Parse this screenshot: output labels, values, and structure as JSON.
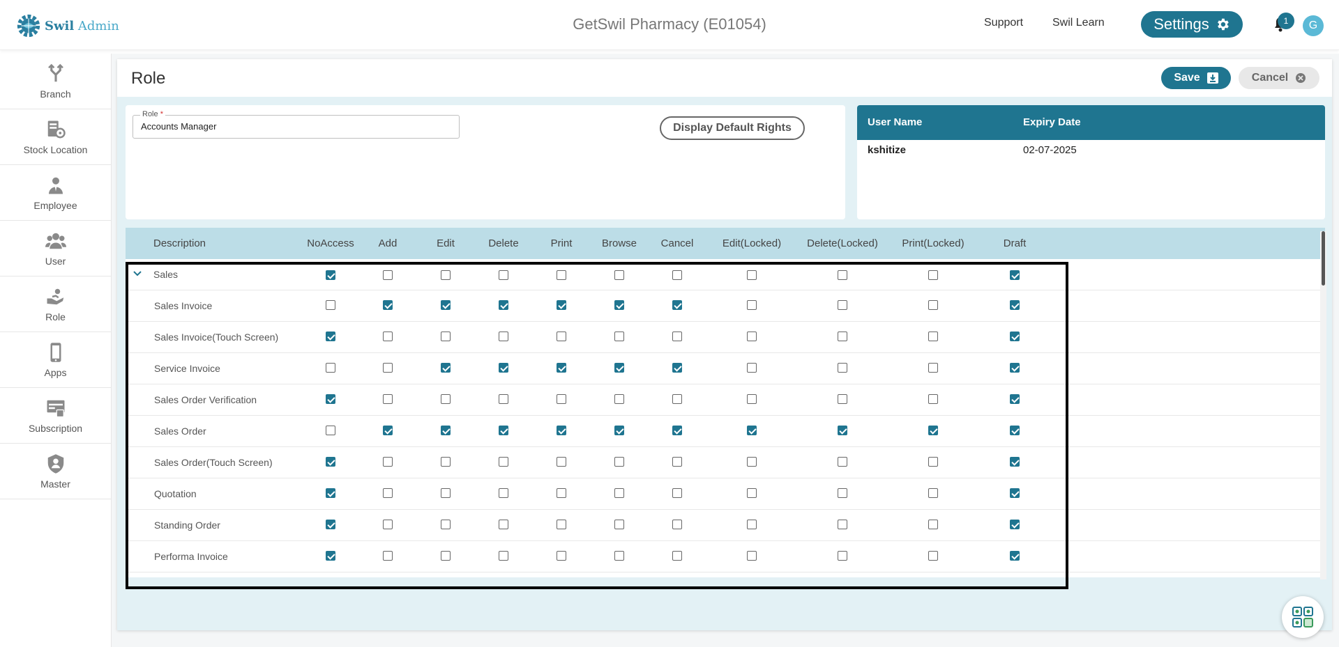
{
  "brand": {
    "name": "Swil",
    "suffix": " Admin"
  },
  "header": {
    "title": "GetSwil Pharmacy (E01054)",
    "support": "Support",
    "learn": "Swil Learn",
    "settings": "Settings",
    "notifications": "1",
    "avatar": "G"
  },
  "sidebar": {
    "items": [
      {
        "label": "Branch",
        "icon": "branch-icon"
      },
      {
        "label": "Stock Location",
        "icon": "stock-location-icon"
      },
      {
        "label": "Employee",
        "icon": "employee-icon"
      },
      {
        "label": "User",
        "icon": "user-icon"
      },
      {
        "label": "Role",
        "icon": "role-icon"
      },
      {
        "label": "Apps",
        "icon": "phone-icon"
      },
      {
        "label": "Subscription",
        "icon": "subscription-icon"
      },
      {
        "label": "Master",
        "icon": "shield-user-icon"
      }
    ]
  },
  "page": {
    "title": "Role",
    "save": "Save",
    "cancel": "Cancel"
  },
  "form": {
    "role_label": "Role",
    "required_mark": "*",
    "role_value": "Accounts Manager",
    "default_rights": "Display Default Rights"
  },
  "users": {
    "headers": [
      "User Name",
      "Expiry Date"
    ],
    "rows": [
      {
        "name": "kshitize",
        "expiry": "02-07-2025"
      }
    ]
  },
  "rights": {
    "columns": [
      "Description",
      "NoAccess",
      "Add",
      "Edit",
      "Delete",
      "Print",
      "Browse",
      "Cancel",
      "Edit(Locked)",
      "Delete(Locked)",
      "Print(Locked)",
      "Draft"
    ],
    "rows": [
      {
        "label": "Sales",
        "group": true,
        "checks": [
          1,
          0,
          0,
          0,
          0,
          0,
          0,
          0,
          0,
          0,
          1
        ]
      },
      {
        "label": "Sales Invoice",
        "checks": [
          0,
          1,
          1,
          1,
          1,
          1,
          1,
          0,
          0,
          0,
          1
        ]
      },
      {
        "label": "Sales Invoice(Touch Screen)",
        "checks": [
          1,
          0,
          0,
          0,
          0,
          0,
          0,
          0,
          0,
          0,
          1
        ]
      },
      {
        "label": "Service Invoice",
        "checks": [
          0,
          0,
          1,
          1,
          1,
          1,
          1,
          0,
          0,
          0,
          1
        ]
      },
      {
        "label": "Sales Order Verification",
        "checks": [
          1,
          0,
          0,
          0,
          0,
          0,
          0,
          0,
          0,
          0,
          1
        ]
      },
      {
        "label": "Sales Order",
        "checks": [
          0,
          1,
          1,
          1,
          1,
          1,
          1,
          1,
          1,
          1,
          1
        ]
      },
      {
        "label": "Sales Order(Touch Screen)",
        "checks": [
          1,
          0,
          0,
          0,
          0,
          0,
          0,
          0,
          0,
          0,
          1
        ]
      },
      {
        "label": "Quotation",
        "checks": [
          1,
          0,
          0,
          0,
          0,
          0,
          0,
          0,
          0,
          0,
          1
        ]
      },
      {
        "label": "Standing Order",
        "checks": [
          1,
          0,
          0,
          0,
          0,
          0,
          0,
          0,
          0,
          0,
          1
        ]
      },
      {
        "label": "Performa Invoice",
        "checks": [
          1,
          0,
          0,
          0,
          0,
          0,
          0,
          0,
          0,
          0,
          1
        ]
      }
    ]
  },
  "colors": {
    "accent": "#1f7590",
    "table_header": "#bcdde7"
  }
}
